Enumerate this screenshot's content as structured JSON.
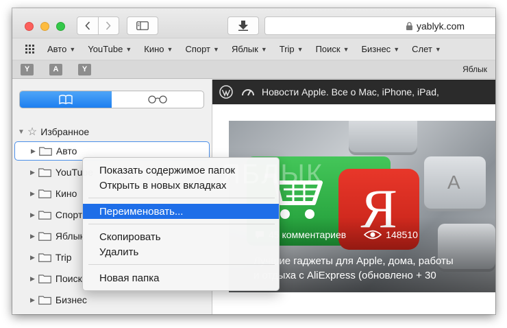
{
  "window": {
    "address": "yablyk.com"
  },
  "favorites_bar": {
    "items": [
      {
        "label": "Авто"
      },
      {
        "label": "YouTube"
      },
      {
        "label": "Кино"
      },
      {
        "label": "Спорт"
      },
      {
        "label": "Яблык"
      },
      {
        "label": "Trip"
      },
      {
        "label": "Поиск"
      },
      {
        "label": "Бизнес"
      },
      {
        "label": "Слет"
      }
    ]
  },
  "tabs": {
    "icons": [
      "Y",
      "A",
      "Y"
    ],
    "label": "Яблык"
  },
  "sidebar": {
    "segments": [
      "bookmarks-icon",
      "reading-list-icon"
    ],
    "favorites_label": "Избранное",
    "folders": [
      {
        "label": "Авто"
      },
      {
        "label": "YouTube"
      },
      {
        "label": "Кино"
      },
      {
        "label": "Спорт"
      },
      {
        "label": "Яблык"
      },
      {
        "label": "Trip"
      },
      {
        "label": "Поиск"
      },
      {
        "label": "Бизнес"
      }
    ]
  },
  "page": {
    "site_title": "Новости Apple. Все о Mac, iPhone, iPad,",
    "hero_letter": "Я",
    "comments": "45 комментариев",
    "views": "148510",
    "headline_line1": "Лучшие гаджеты для Apple, дома, работы",
    "headline_line2": "и отдыха с AliExpress (обновлено + 30",
    "key_a_letter": "A",
    "watermark": "ЯБЛЫК"
  },
  "context_menu": {
    "show_contents": "Показать содержимое папок",
    "open_in_tabs": "Открыть в новых вкладках",
    "rename": "Переименовать...",
    "copy": "Скопировать",
    "delete": "Удалить",
    "new_folder": "Новая папка"
  },
  "colors": {
    "accent": "#1e6ee8",
    "close": "#fc605c",
    "minimize": "#fdbc40",
    "zoom": "#34c84a",
    "brand_red": "#d62a1f"
  }
}
